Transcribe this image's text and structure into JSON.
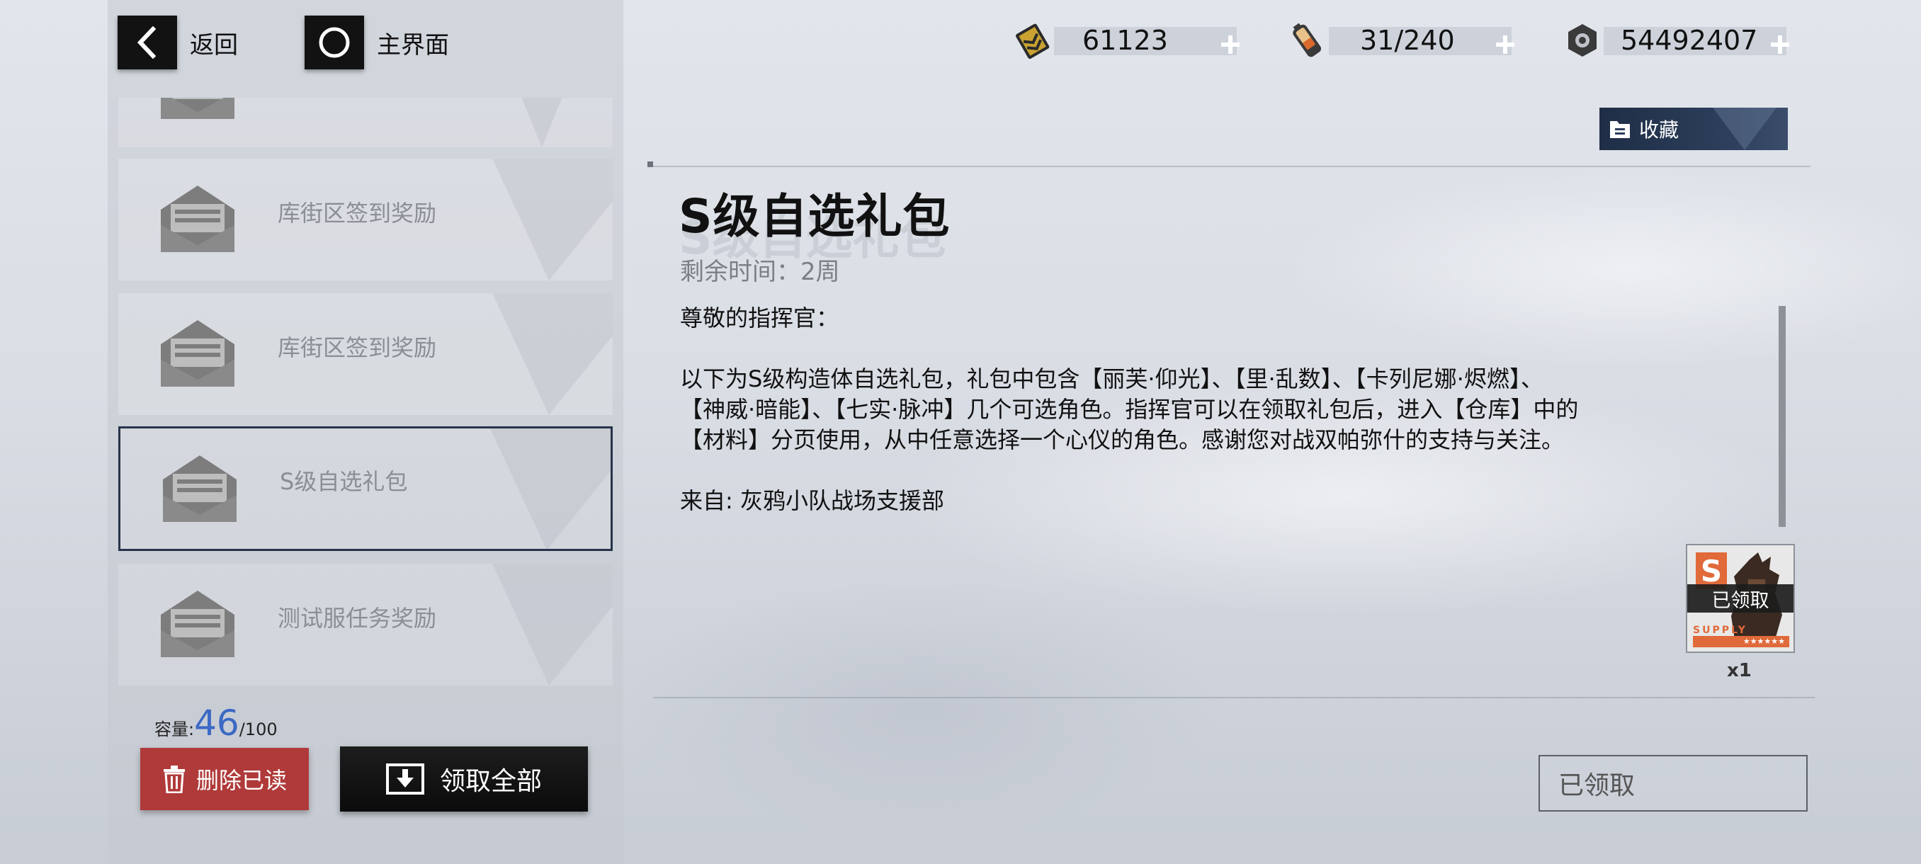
{
  "nav": {
    "back_label": "返回",
    "home_label": "主界面"
  },
  "currencies": [
    {
      "icon": "ticket-icon",
      "value": "61123"
    },
    {
      "icon": "battery-icon",
      "value": "31/240"
    },
    {
      "icon": "hex-nut-icon",
      "value": "54492407"
    }
  ],
  "mail_list": {
    "items": [
      {
        "title": "",
        "state": "read"
      },
      {
        "title": "库街区签到奖励",
        "state": "read"
      },
      {
        "title": "库街区签到奖励",
        "state": "read"
      },
      {
        "title": "S级自选礼包",
        "state": "selected"
      },
      {
        "title": "测试服任务奖励",
        "state": "read"
      }
    ],
    "capacity_label": "容量:",
    "capacity_value": "46",
    "capacity_max": "/100",
    "delete_read_label": "删除已读",
    "claim_all_label": "领取全部"
  },
  "detail": {
    "favorite_label": "收藏",
    "title": "S级自选礼包",
    "remaining": "剩余时间：2周",
    "greeting": "尊敬的指挥官：",
    "body": "以下为S级构造体自选礼包，礼包中包含【丽芙·仰光】、【里·乱数】、【卡列尼娜·烬燃】、\n【神威·暗能】、【七实·脉冲】几个可选角色。指挥官可以在领取礼包后，进入【仓库】中的\n【材料】分页使用，从中任意选择一个心仪的角色。感谢您对战双帕弥什的支持与关注。",
    "sender": "来自: 灰鸦小队战场支援部",
    "reward": {
      "badge_letter": "S",
      "brand": "SUPPLY",
      "stars": "★★★★★★",
      "claimed_tag": "已领取",
      "count": "x1"
    },
    "claimed_button": "已领取"
  },
  "colors": {
    "accent_blue": "#3b69c4",
    "delete_red": "#b03a3a",
    "selected_border": "#26334a",
    "favorite_navy": "#1f2e46"
  }
}
